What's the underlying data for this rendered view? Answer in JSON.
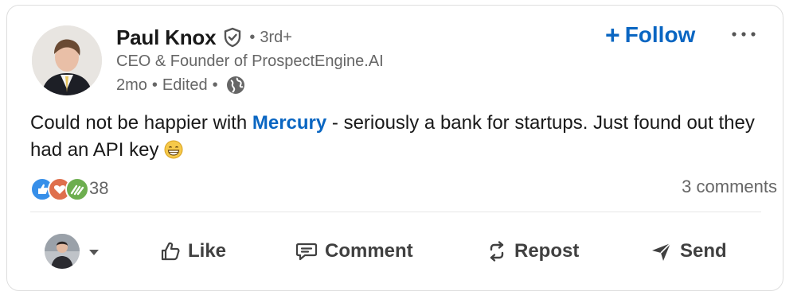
{
  "post": {
    "author": {
      "name": "Paul Knox",
      "degree": "3rd+",
      "headline": "CEO & Founder of ProspectEngine.AI",
      "time": "2mo",
      "edited": "Edited"
    },
    "follow_label": "Follow",
    "body_before": "Could not be happier with ",
    "mention": "Mercury",
    "body_after": " - seriously a bank for startups. Just found out they had an API key",
    "reactions_count": "38",
    "comments_label": "3 comments"
  },
  "actions": {
    "like": "Like",
    "comment": "Comment",
    "repost": "Repost",
    "send": "Send"
  },
  "icons": {
    "verified": "verified-shield-icon",
    "visibility": "globe-icon",
    "more": "more-icon",
    "emoji": "grinning-face-emoji"
  },
  "colors": {
    "accent": "#0a66c2",
    "secondary_text": "#666666",
    "like": "#378fe9",
    "love": "#df704d",
    "support": "#6dae4f"
  }
}
